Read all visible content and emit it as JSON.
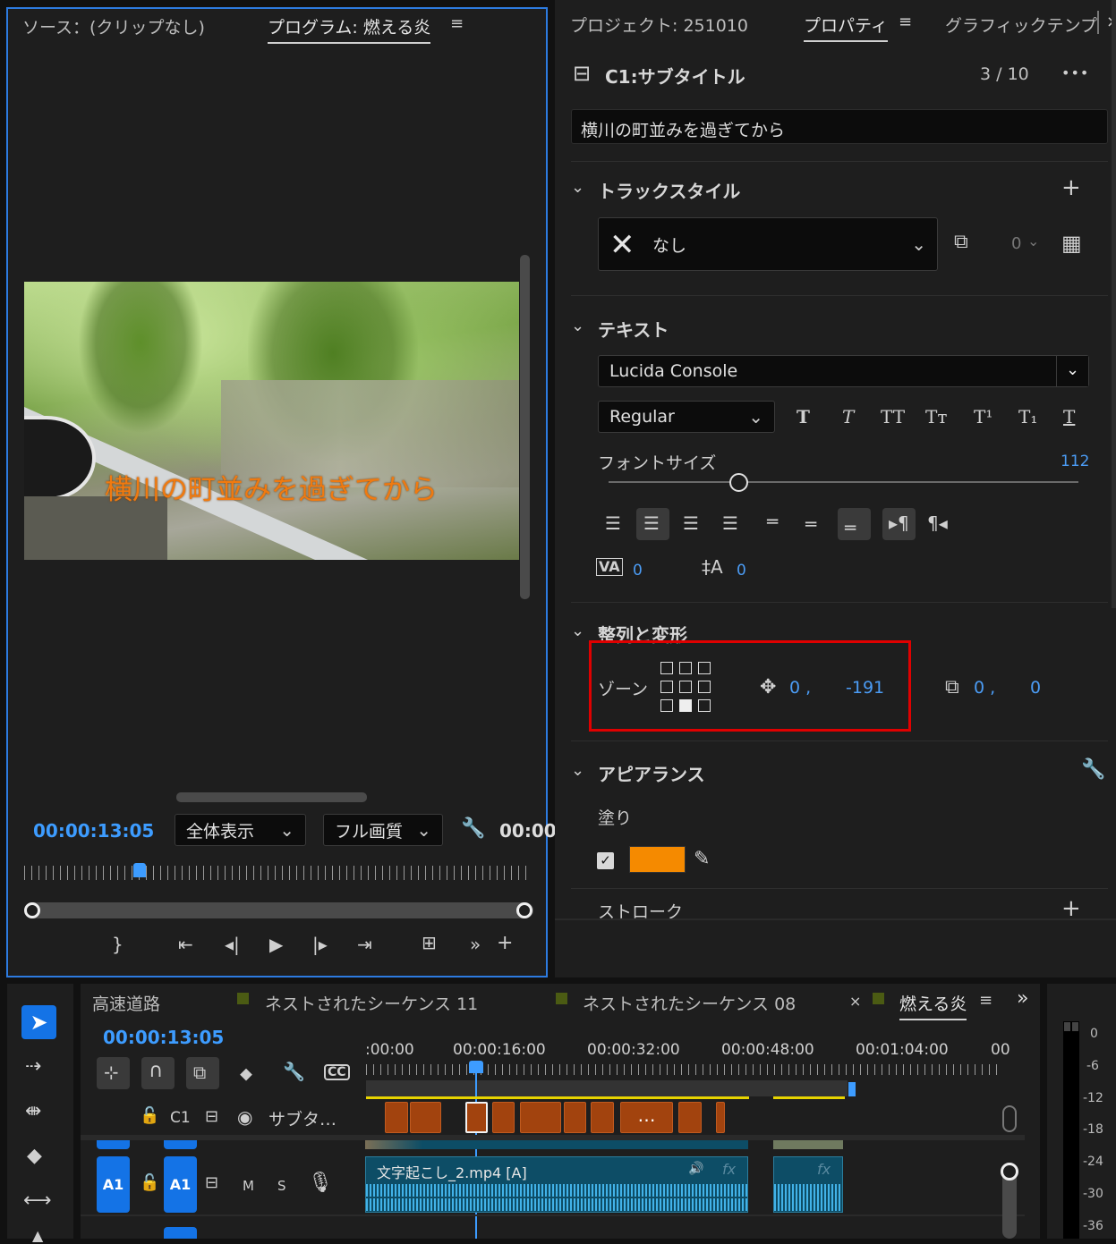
{
  "source_monitor": {
    "source_tab": "ソース：(クリップなし)",
    "program_tab": "プログラム: 燃える炎",
    "subtitle_text": "横川の町並みを過ぎてから",
    "timecode": "00:00:13:05",
    "fit_label": "全体表示",
    "quality_label": "フル画質",
    "timecode_right": "00:00"
  },
  "properties": {
    "tab_project": "プロジェクト: 251010",
    "tab_properties": "プロパティ",
    "tab_graphics": "グラフィックテンプ",
    "caption_title": "C1:サブタイトル",
    "caption_count": "3 / 10",
    "more_label": "•••",
    "caption_text": "横川の町並みを過ぎてから",
    "track_style": {
      "heading": "トラックスタイル",
      "value": "なし",
      "count": "0"
    },
    "text": {
      "heading": "テキスト",
      "font_family": "Lucida Console",
      "font_style": "Regular",
      "style_buttons": [
        "T",
        "T",
        "TT",
        "Tт",
        "T¹",
        "T₁",
        "T"
      ],
      "font_size_label": "フォントサイズ",
      "font_size_value": "112",
      "font_size_fraction": 0.277,
      "tracking_value": "0",
      "leading_value": "0"
    },
    "align": {
      "heading": "整列と変形",
      "zone_label": "ゾーン",
      "pos_x": "0 ,",
      "pos_y": "-191",
      "scale_x": "0 ,",
      "scale_y": "0"
    },
    "appearance": {
      "heading": "アピアランス",
      "fill_label": "塗り",
      "fill_color": "#f58a00",
      "stroke_label": "ストローク"
    }
  },
  "timeline": {
    "tabs": [
      "高速道路",
      "ネストされたシーケンス 11",
      "ネストされたシーケンス 08",
      "燃える炎"
    ],
    "tab_close": "×",
    "timecode": "00:00:13:05",
    "ruler_labels": [
      ":00:00",
      "00:00:16:00",
      "00:00:32:00",
      "00:00:48:00",
      "00:01:04:00",
      "00"
    ],
    "caption_track_label": "C1",
    "caption_track_name": "サブタ…",
    "audio_track_badge": "A1",
    "audio_track_label": "A1",
    "audio_m": "M",
    "audio_s": "S",
    "clip_name": "文字起こし_2.mp4 [A]",
    "fx_label": "fx",
    "ellipsis": "…",
    "more_tabs": "»"
  },
  "meter": {
    "ticks": [
      "0",
      "-6",
      "-12",
      "-18",
      "-24",
      "-30",
      "-36"
    ]
  },
  "colors": {
    "accent_blue": "#3d9cff",
    "highlight_box": "#e00000",
    "subtitle_orange": "#f07a10",
    "clip_orange": "#a2430e"
  }
}
